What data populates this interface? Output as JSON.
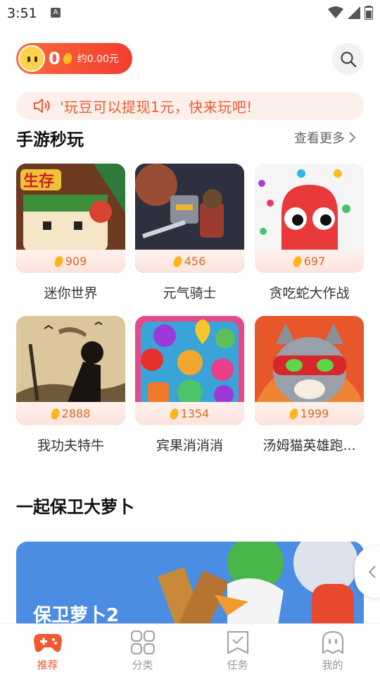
{
  "status_bar": {
    "time": "3:51",
    "notification_icon": "A"
  },
  "header": {
    "bean_count": "0",
    "yuan_text": "约0.00元"
  },
  "notice": {
    "text": "'玩豆可以提现1元，快来玩吧!"
  },
  "section_games": {
    "title": "手游秒玩",
    "more_label": "查看更多",
    "games": [
      {
        "name": "迷你世界",
        "beans": "909"
      },
      {
        "name": "元气骑士",
        "beans": "456"
      },
      {
        "name": "贪吃蛇大作战",
        "beans": "697"
      },
      {
        "name": "我功夫特牛",
        "beans": "2888"
      },
      {
        "name": "宾果消消消",
        "beans": "1354"
      },
      {
        "name": "汤姆猫英雄跑...",
        "beans": "1999"
      }
    ]
  },
  "section_banner": {
    "title": "一起保卫大萝卜",
    "banner_game": "保卫萝卜2"
  },
  "bottom_nav": [
    {
      "label": "推荐",
      "icon": "gamepad-icon",
      "active": true
    },
    {
      "label": "分类",
      "icon": "grid-icon",
      "active": false
    },
    {
      "label": "任务",
      "icon": "task-check-icon",
      "active": false
    },
    {
      "label": "我的",
      "icon": "ghost-profile-icon",
      "active": false
    }
  ],
  "colors": {
    "accent": "#f2572f",
    "notice_bg": "#fdf0ea",
    "price_text": "#d86a2a"
  }
}
